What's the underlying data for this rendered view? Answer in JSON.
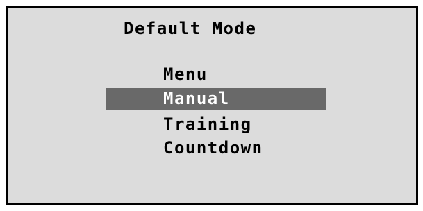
{
  "screen": {
    "title": "Default Mode",
    "menu": {
      "selected_index": 1,
      "items": [
        {
          "label": "Menu"
        },
        {
          "label": "Manual"
        },
        {
          "label": "Training"
        },
        {
          "label": "Countdown"
        }
      ]
    }
  },
  "colors": {
    "background": "#dcdcdc",
    "text": "#000000",
    "selection_background": "#696969",
    "selection_text": "#ffffff"
  }
}
